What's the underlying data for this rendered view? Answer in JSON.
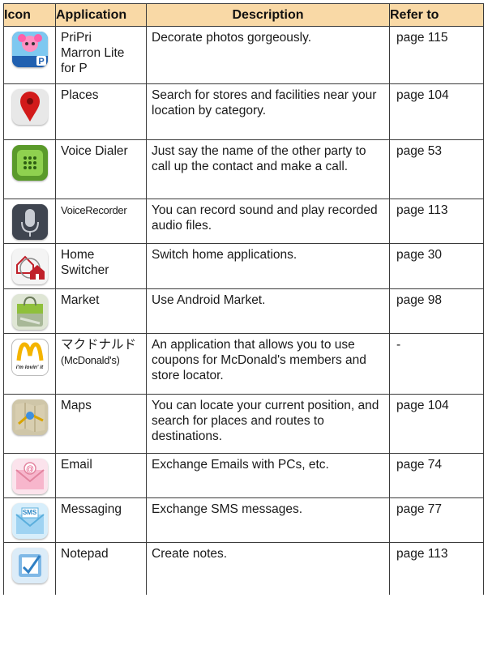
{
  "table": {
    "headers": {
      "icon": "Icon",
      "application": "Application",
      "description": "Description",
      "refer_to": "Refer to"
    },
    "rows": [
      {
        "icon": "pripri-marron-icon",
        "app_line1": "PriPri",
        "app_line2": "Marron Lite",
        "app_line3": "for P",
        "description": "Decorate photos gorgeously.",
        "ref": "page 115"
      },
      {
        "icon": "places-pin-icon",
        "app_line1": "Places",
        "description": "Search for stores and facilities near your location by category.",
        "ref": "page 104"
      },
      {
        "icon": "voice-dialer-icon",
        "app_line1": "Voice Dialer",
        "description": "Just say the name of the other party to call up the contact and make a call.",
        "ref": "page 53"
      },
      {
        "icon": "microphone-icon",
        "app_line1": "VoiceRecorder",
        "description": "You can record sound and play recorded audio files.",
        "ref": "page 113"
      },
      {
        "icon": "home-switcher-icon",
        "app_line1": "Home",
        "app_line2": "Switcher",
        "description": "Switch home applications.",
        "ref": "page 30"
      },
      {
        "icon": "market-bag-icon",
        "app_line1": "Market",
        "description": "Use Android Market.",
        "ref": "page 98"
      },
      {
        "icon": "mcdonalds-logo-icon",
        "icon_caption": "i'm lovin' it",
        "app_line1": "マクドナルド",
        "app_line2": "(McDonald's)",
        "description": "An application that allows you to use coupons for McDonald's members and store locator.",
        "ref": "-"
      },
      {
        "icon": "maps-icon",
        "app_line1": "Maps",
        "description": "You can locate your current position, and search for places and routes to destinations.",
        "ref": "page 104"
      },
      {
        "icon": "email-envelope-icon",
        "app_line1": "Email",
        "description": "Exchange Emails with PCs, etc.",
        "ref": "page 74"
      },
      {
        "icon": "sms-envelope-icon",
        "icon_caption": "SMS",
        "app_line1": "Messaging",
        "description": "Exchange SMS messages.",
        "ref": "page 77"
      },
      {
        "icon": "notepad-icon",
        "app_line1": "Notepad",
        "description": "Create notes.",
        "ref": "page 113"
      }
    ]
  },
  "colors": {
    "header_bg": "#f9d9a6",
    "border": "#3a3a3a"
  }
}
